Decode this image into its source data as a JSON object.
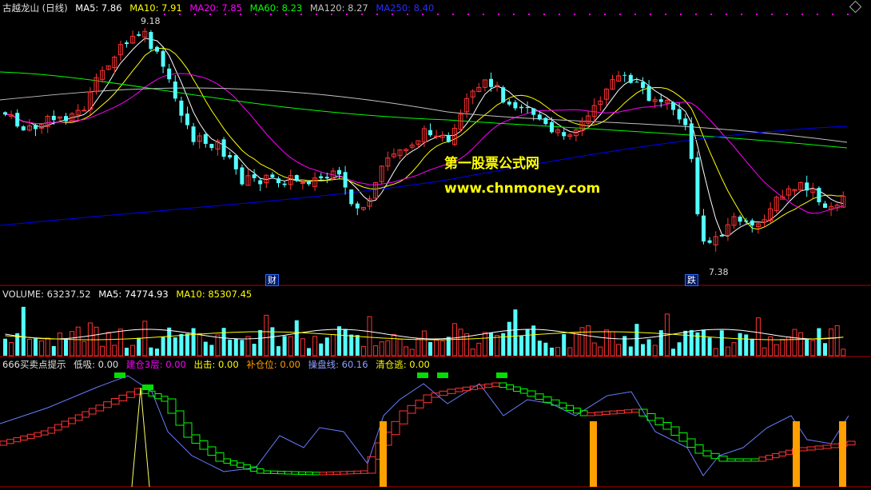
{
  "main_header": {
    "title": "古越龙山 (日线)",
    "ma5": "MA5: 7.86",
    "ma10": "MA10: 7.91",
    "ma20": "MA20: 7.85",
    "ma60": "MA60: 8.23",
    "ma120": "MA120: 8.27",
    "ma250": "MA250: 8.40"
  },
  "price_labels": {
    "high": "9.18",
    "low": "7.38"
  },
  "event_tags": {
    "cai": "财",
    "die": "跌"
  },
  "watermark": {
    "line1": "第一股票公式网",
    "line2": "www.chnmoney.com"
  },
  "volume_header": {
    "volume": "VOLUME: 63237.52",
    "ma5": "MA5: 74774.93",
    "ma10": "MA10: 85307.45"
  },
  "indicator_header": {
    "name": "666买卖点提示",
    "dixi": "低吸: 0.00",
    "jiancang": "建仓3层: 0.00",
    "chuji": "出击: 0.00",
    "bucang": "补仓位: 0.00",
    "caopan": "操盘线: 60.16",
    "qingcang": "清仓逃: 0.00"
  },
  "colors": {
    "up": "#ff3232",
    "down": "#54ffff",
    "ma5": "#ffffff",
    "ma10": "#ffff00",
    "ma20": "#ff00ff",
    "ma60": "#00ff00",
    "ma120": "#c0c0c0",
    "ma250": "#0000ff",
    "separator": "#b00000",
    "caopan_line": "#6a7dff",
    "bar_orange": "#ff9f00",
    "signal_green": "#00e000"
  },
  "chart_data": {
    "type": "candlestick",
    "y_axis_range": [
      7.38,
      9.18
    ],
    "annotated_high": 9.18,
    "annotated_low": 7.38,
    "last_values": {
      "ma5": 7.86,
      "ma10": 7.91,
      "ma20": 7.85,
      "ma60": 8.23,
      "ma120": 8.27,
      "ma250": 8.4,
      "volume": 63237.52,
      "vol_ma5": 74774.93,
      "vol_ma10": 85307.45,
      "caopan": 60.16
    }
  }
}
